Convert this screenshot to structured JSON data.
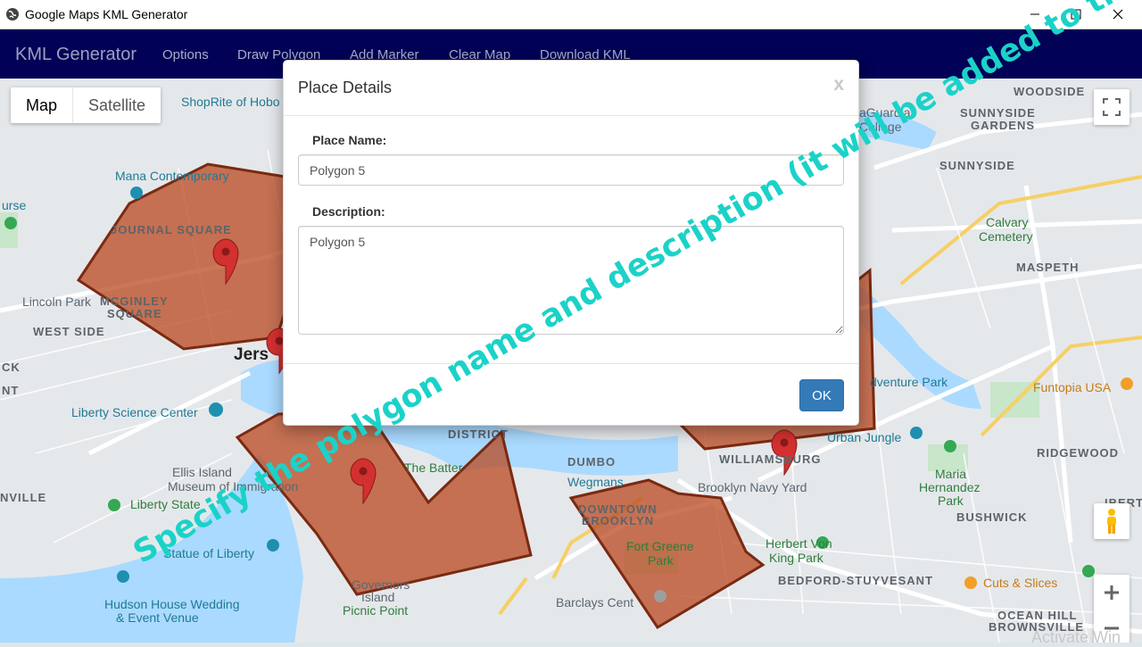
{
  "window": {
    "title": "Google Maps KML Generator",
    "minimize_icon": "minimize-icon",
    "maximize_icon": "maximize-icon",
    "close_icon": "close-icon"
  },
  "navbar": {
    "brand": "KML Generator",
    "items": [
      "Options",
      "Draw Polygon",
      "Add Marker",
      "Clear Map",
      "Download KML"
    ]
  },
  "map": {
    "type_buttons": [
      "Map",
      "Satellite"
    ],
    "labels": {
      "shoprite": "ShopRite of Hobo",
      "mana": "Mana Contemporary",
      "journal_square": "JOURNAL SQUARE",
      "lincoln_park": "Lincoln Park",
      "mcginley": "MCGINLEY",
      "square": "SQUARE",
      "west_side": "WEST SIDE",
      "jersey": "Jers",
      "liberty_science": "Liberty Science Center",
      "ellis": "Ellis Island",
      "immigration": "Museum of Immigration",
      "liberty_state": "Liberty State",
      "statue": "Statue of Liberty",
      "hudson_house": "Hudson House Wedding",
      "event_venue": "& Event Venue",
      "governors": "Governors",
      "island": "Island",
      "picnic": "Picnic Point",
      "the_battery": "The Batter",
      "district": "DISTRICT",
      "dumbo": "DUMBO",
      "wegmans": "Wegmans",
      "downtown": "DOWNTOWN",
      "brooklyn": "BROOKLYN",
      "fort_greene": "Fort Greene",
      "park": "Park",
      "barclays": "Barclays Cent",
      "brooklyn_navy": "Brooklyn Navy Yard",
      "williamsburg": "WILLIAMSBURG",
      "herbert_von": "Herbert Von",
      "king_park": "King Park",
      "bedford": "BEDFORD-STUYVESANT",
      "ocean_hill": "OCEAN HILL",
      "brownsville": "BROWNSVILLE",
      "laguardia": "aGuardia",
      "college": "College",
      "woodside": "WOODSIDE",
      "sunnyside_gardens": "SUNNYSIDE",
      "gardens": "GARDENS",
      "sunnyside": "SUNNYSIDE",
      "calvary": "Calvary",
      "cemetery": "Cemetery",
      "maspeth": "MASPETH",
      "adventure_park": "dventure Park",
      "funtopia": "Funtopia USA",
      "urban_jungle": "Urban Jungle",
      "ridgewood": "RIDGEWOOD",
      "maria": "Maria",
      "hernandez": "Hernandez",
      "maria_park": "Park",
      "bushwick": "BUSHWICK",
      "cuts": "Cuts & Slices",
      "nville": "NVILLE",
      "ck": "CK",
      "nt": "NT",
      "urse": "urse",
      "ibert": "IBERT"
    }
  },
  "modal": {
    "title": "Place Details",
    "close_glyph": "x",
    "name_label": "Place Name:",
    "name_value": "Polygon 5",
    "desc_label": "Description:",
    "desc_value": "Polygon 5",
    "ok_label": "OK"
  },
  "annotation": "Specify the polygon name and description (it will be added to the KML).",
  "watermark": "Activate Win",
  "colors": {
    "navbar": "#010156",
    "polygon_fill": "#b9481f",
    "polygon_stroke": "#7a2a12",
    "marker": "#d33030",
    "ok_button": "#337ab7",
    "annotation": "#1bd2c8"
  }
}
